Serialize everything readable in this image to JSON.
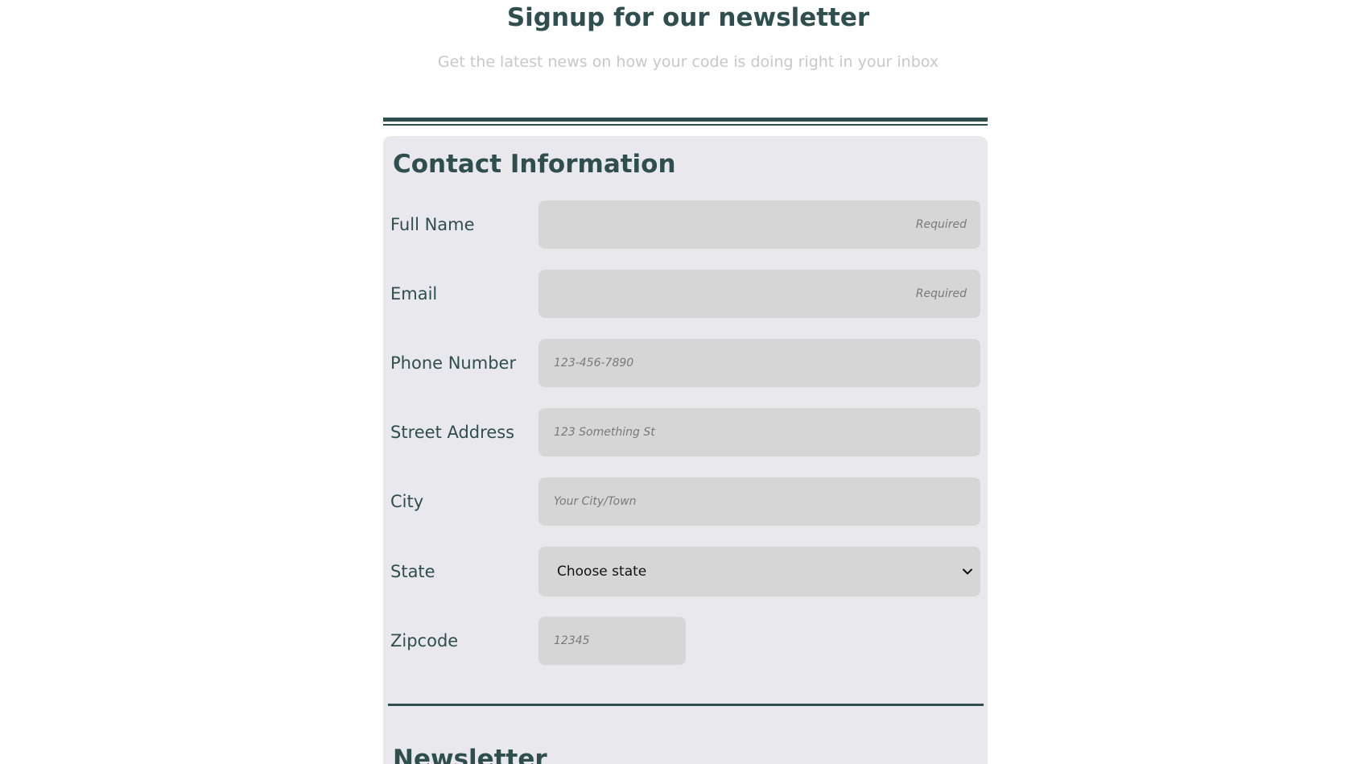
{
  "header": {
    "title": "Signup for our newsletter",
    "subtitle": "Get the latest news on how your code is doing right in your inbox"
  },
  "contact": {
    "title": "Contact Information",
    "fields": [
      {
        "label": "Full Name",
        "placeholder": "Required"
      },
      {
        "label": "Email",
        "placeholder": "Required"
      },
      {
        "label": "Phone Number",
        "placeholder": "123-456-7890"
      },
      {
        "label": "Street Address",
        "placeholder": "123 Something St"
      },
      {
        "label": "City",
        "placeholder": "Your City/Town"
      },
      {
        "label": "State",
        "value": "Choose state"
      },
      {
        "label": "Zipcode",
        "placeholder": "12345"
      }
    ]
  },
  "newsletter": {
    "title": "Newsletter"
  },
  "colors": {
    "accent": "#2f4f4f",
    "card": "#e9e8ec",
    "field": "#d6d6d6",
    "subtitle": "#c8c8c8"
  },
  "icons": {
    "select_arrow": "chevron-down-icon"
  }
}
